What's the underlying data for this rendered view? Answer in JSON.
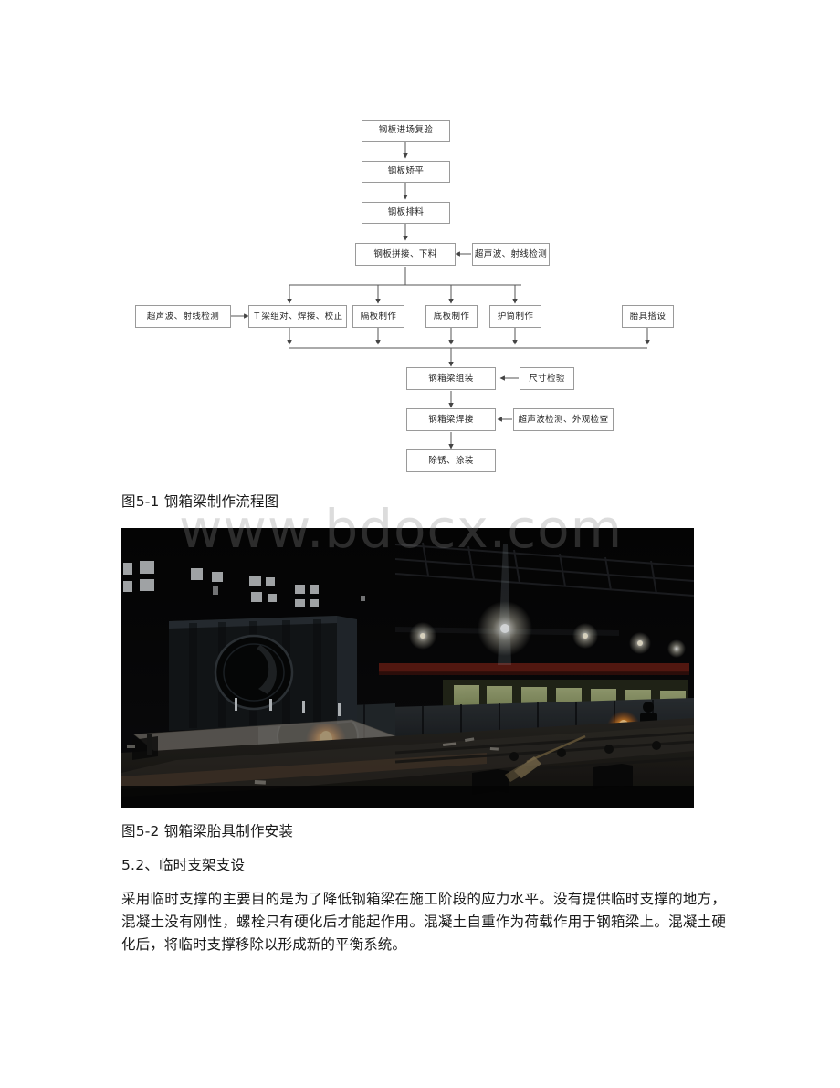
{
  "document": {
    "watermark": "www.bdocx.com",
    "figure1_caption": "图5-1 钢箱梁制作流程图",
    "figure2_caption": "图5-2 钢箱梁胎具制作安装",
    "section_heading": "5.2、临时支架支设",
    "body_paragraph": "采用临时支撑的主要目的是为了降低钢箱梁在施工阶段的应力水平。没有提供临时支撑的地方，混凝土没有刚性，螺栓只有硬化后才能起作用。混凝土自重作为荷载作用于钢箱梁上。混凝土硬化后，将临时支撑移除以形成新的平衡系统。"
  },
  "flowchart": {
    "title": "钢箱梁制作流程图",
    "nodes": {
      "n1": "钢板进场复验",
      "n2": "钢板矫平",
      "n3": "钢板排料",
      "n4": "钢板拼接、下料",
      "n4_check": "超声波、射线检测",
      "n5_check": "超声波、射线检测",
      "n5a": "Ｔ梁组对、焊接、校正",
      "n5b": "隔板制作",
      "n5c": "底板制作",
      "n5d": "护筒制作",
      "n5e": "胎具搭设",
      "n6": "钢箱梁组装",
      "n6_check": "尺寸检验",
      "n7": "钢箱梁焊接",
      "n7_check": "超声波检测、外观检查",
      "n8": "除锈、涂装"
    }
  },
  "photo": {
    "alt_description": "钢箱梁胎具制作安装 - 车间内钢箱梁节段与胎具"
  },
  "colors": {
    "box_border": "#9a9a9a",
    "box_fill": "#ffffff",
    "text": "#1a1a1a",
    "connector": "#555555",
    "watermark": "#8c8c8c"
  }
}
